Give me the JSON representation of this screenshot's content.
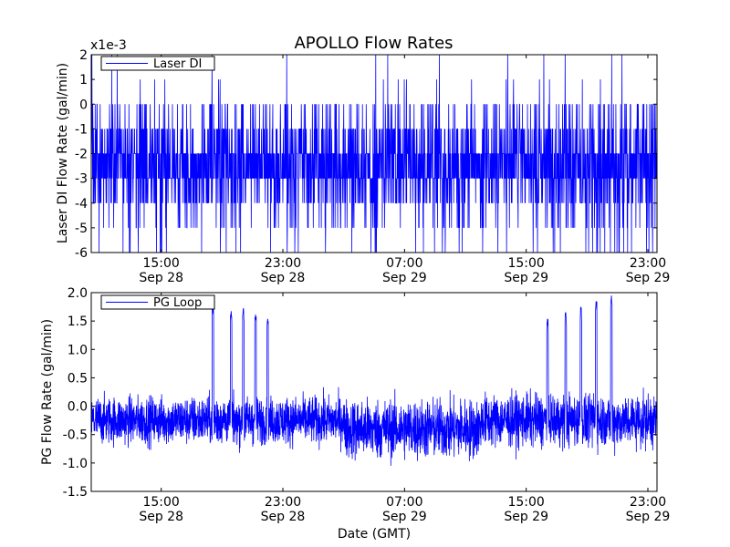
{
  "chart_data": [
    {
      "type": "line",
      "title": "APOLLO Flow Rates",
      "ylabel": "Laser DI Flow Rate (gal/min)",
      "y_offset_label": "x1e-3",
      "y_scale": 0.001,
      "ylim": [
        -6,
        2
      ],
      "yticks": [
        "2",
        "1",
        "0",
        "-1",
        "-2",
        "-3",
        "-4",
        "-5",
        "-6"
      ],
      "xlim_hours_since_sep28_00": [
        10.4,
        47.6
      ],
      "xticks": [
        {
          "time": "15:00",
          "date": "Sep 28"
        },
        {
          "time": "23:00",
          "date": "Sep 28"
        },
        {
          "time": "07:00",
          "date": "Sep 29"
        },
        {
          "time": "15:00",
          "date": "Sep 29"
        },
        {
          "time": "23:00",
          "date": "Sep 29"
        }
      ],
      "series": [
        {
          "name": "Laser DI",
          "color": "#0000ff",
          "values_description": "quantized noise mostly between -4 and -1 (x1e-3), dense around -3 to -2, frequent spikes to 0 and -5, occasional to 1/2 and -6"
        }
      ],
      "legend": "top-left"
    },
    {
      "type": "line",
      "title": "",
      "ylabel": "PG Flow Rate (gal/min)",
      "xlabel": "Date (GMT)",
      "ylim": [
        -1.5,
        2.0
      ],
      "yticks": [
        "2.0",
        "1.5",
        "1.0",
        "0.5",
        "0.0",
        "-0.5",
        "-1.0",
        "-1.5"
      ],
      "xlim_hours_since_sep28_00": [
        10.4,
        47.6
      ],
      "xticks": [
        {
          "time": "15:00",
          "date": "Sep 28"
        },
        {
          "time": "23:00",
          "date": "Sep 28"
        },
        {
          "time": "07:00",
          "date": "Sep 29"
        },
        {
          "time": "15:00",
          "date": "Sep 29"
        },
        {
          "time": "23:00",
          "date": "Sep 29"
        }
      ],
      "series": [
        {
          "name": "PG Loop",
          "color": "#0000ff",
          "baseline_range": [
            -0.9,
            0.4
          ],
          "spikes": [
            {
              "hour": 18.4,
              "value": 1.75
            },
            {
              "hour": 19.6,
              "value": 1.68
            },
            {
              "hour": 20.4,
              "value": 1.72
            },
            {
              "hour": 21.2,
              "value": 1.62
            },
            {
              "hour": 22.0,
              "value": 1.55
            },
            {
              "hour": 40.4,
              "value": 1.55
            },
            {
              "hour": 41.6,
              "value": 1.65
            },
            {
              "hour": 42.6,
              "value": 1.75
            },
            {
              "hour": 43.6,
              "value": 1.85
            },
            {
              "hour": 44.6,
              "value": 1.95
            }
          ]
        }
      ],
      "legend": "top-left"
    }
  ]
}
